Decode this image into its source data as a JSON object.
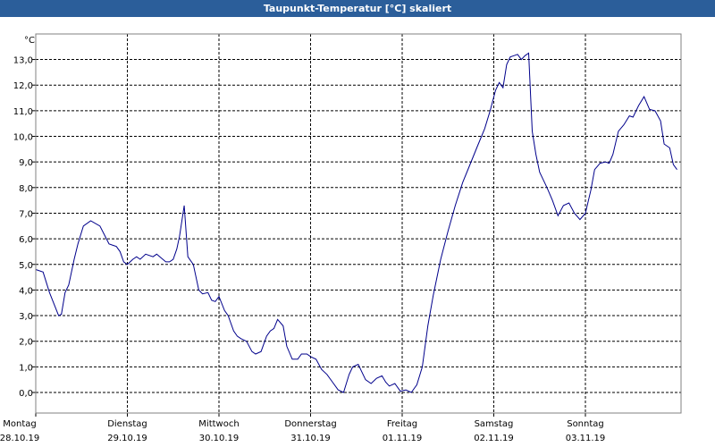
{
  "window": {
    "title": "Taupunkt-Temperatur [°C] skaliert"
  },
  "colors": {
    "titlebar": "#2b5e9a",
    "line": "#00008b",
    "grid": "#000000",
    "background": "#ffffff"
  },
  "chart_data": {
    "type": "line",
    "title": "Taupunkt-Temperatur [°C] skaliert",
    "ylabel": "°C",
    "ylim": [
      -0.8,
      13.9
    ],
    "yticks": [
      "13,0",
      "12,0",
      "11,0",
      "10,0",
      "9,0",
      "8,0",
      "7,0",
      "6,0",
      "5,0",
      "4,0",
      "3,0",
      "2,0",
      "1,0",
      "0,0"
    ],
    "xlim": [
      0,
      7
    ],
    "grid": true,
    "x_ticks": [
      {
        "day": "Montag",
        "date": "28.10.19"
      },
      {
        "day": "Dienstag",
        "date": "29.10.19"
      },
      {
        "day": "Mittwoch",
        "date": "30.10.19"
      },
      {
        "day": "Donnerstag",
        "date": "31.10.19"
      },
      {
        "day": "Freitag",
        "date": "01.11.19"
      },
      {
        "day": "Samstag",
        "date": "02.11.19"
      },
      {
        "day": "Sonntag",
        "date": "03.11.19"
      }
    ],
    "series": [
      {
        "x": [
          0,
          0.08,
          0.15,
          0.25,
          0.28,
          0.32,
          0.36,
          0.42,
          0.46,
          0.52,
          0.6,
          0.7,
          0.8,
          0.88,
          0.92,
          0.96,
          1.0,
          1.06,
          1.1,
          1.14,
          1.2,
          1.28,
          1.32,
          1.42,
          1.46,
          1.5,
          1.54,
          1.57,
          1.62,
          1.66,
          1.72,
          1.78,
          1.82,
          1.88,
          1.92,
          1.96,
          2.0,
          2.06,
          2.1,
          2.16,
          2.2,
          2.24,
          2.3,
          2.36,
          2.4,
          2.46,
          2.52,
          2.56,
          2.6,
          2.64,
          2.7,
          2.74,
          2.8,
          2.86,
          2.9,
          2.96,
          3.0,
          3.06,
          3.12,
          3.18,
          3.24,
          3.3,
          3.36,
          3.42,
          3.46,
          3.52,
          3.6,
          3.66,
          3.72,
          3.78,
          3.82,
          3.86,
          3.92,
          3.98,
          4.04,
          4.1,
          4.16,
          4.22,
          4.28,
          4.34,
          4.42,
          4.5,
          4.58,
          4.66,
          4.74,
          4.82,
          4.9,
          4.96,
          5.02,
          5.06,
          5.1,
          5.14,
          5.18,
          5.22,
          5.26,
          5.3,
          5.34,
          5.38,
          5.42,
          5.46,
          5.5,
          5.54,
          5.58,
          5.64,
          5.7,
          5.76,
          5.82,
          5.88,
          5.94,
          6.0,
          6.06,
          6.1,
          6.16,
          6.22,
          6.26,
          6.3,
          6.36,
          6.42,
          6.48,
          6.52,
          6.58,
          6.64,
          6.7,
          6.76,
          6.82,
          6.86,
          6.92,
          6.96,
          7.0
        ],
        "y": [
          4.8,
          4.7,
          3.9,
          3.0,
          3.05,
          3.9,
          4.2,
          5.2,
          5.8,
          6.5,
          6.7,
          6.5,
          5.8,
          5.7,
          5.5,
          5.1,
          5.0,
          5.2,
          5.3,
          5.2,
          5.4,
          5.3,
          5.4,
          5.1,
          5.1,
          5.2,
          5.6,
          6.1,
          7.3,
          5.3,
          5.0,
          4.0,
          3.85,
          3.9,
          3.6,
          3.55,
          3.75,
          3.2,
          3.0,
          2.4,
          2.2,
          2.1,
          2.0,
          1.6,
          1.5,
          1.6,
          2.2,
          2.4,
          2.5,
          2.85,
          2.6,
          1.8,
          1.3,
          1.3,
          1.5,
          1.5,
          1.4,
          1.3,
          0.9,
          0.7,
          0.4,
          0.1,
          0.0,
          0.7,
          1.0,
          1.1,
          0.5,
          0.35,
          0.55,
          0.65,
          0.4,
          0.25,
          0.35,
          0.05,
          0.1,
          0.0,
          0.3,
          1.0,
          2.6,
          3.8,
          5.2,
          6.3,
          7.3,
          8.2,
          8.9,
          9.6,
          10.3,
          11.0,
          11.8,
          12.1,
          11.9,
          12.8,
          13.1,
          13.15,
          13.2,
          13.0,
          13.15,
          13.25,
          10.2,
          9.3,
          8.6,
          8.3,
          8.0,
          7.5,
          6.9,
          7.3,
          7.4,
          7.0,
          6.75,
          7.0,
          7.9,
          8.7,
          8.95,
          9.0,
          8.95,
          9.3,
          10.2,
          10.45,
          10.8,
          10.75,
          11.2,
          11.55,
          11.05,
          11.0,
          10.6,
          9.7,
          9.55,
          8.9,
          8.7
        ]
      }
    ]
  }
}
